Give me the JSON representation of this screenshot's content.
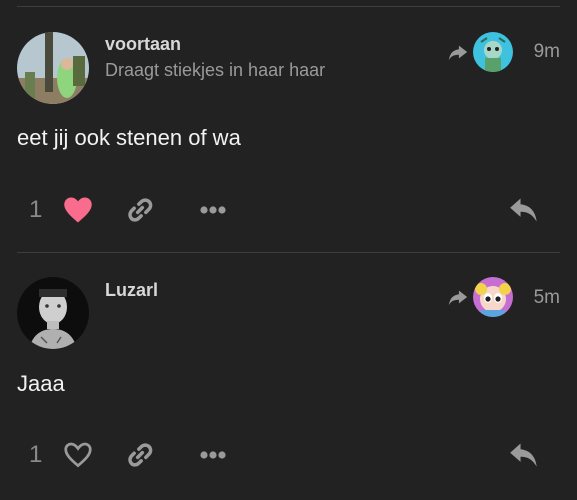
{
  "posts": [
    {
      "username": "voortaan",
      "user_title": "Draagt stiekjes in haar haar",
      "time": "9m",
      "body": "eet jij ook stenen of wa",
      "like_count": "1",
      "liked": true,
      "avatar_icon": "user-avatar-cactus-photo",
      "reply_avatar_icon": "user-avatar-cartoon"
    },
    {
      "username": "Luzarl",
      "user_title": "",
      "time": "5m",
      "body": "Jaaa",
      "like_count": "1",
      "liked": false,
      "avatar_icon": "user-avatar-portrait-photo",
      "reply_avatar_icon": "user-avatar-powerpuff"
    }
  ],
  "colors": {
    "background": "#222222",
    "liked_heart": "#fa6c8d",
    "icon_gray": "#9a9a9a",
    "divider": "#3d3d3d"
  }
}
